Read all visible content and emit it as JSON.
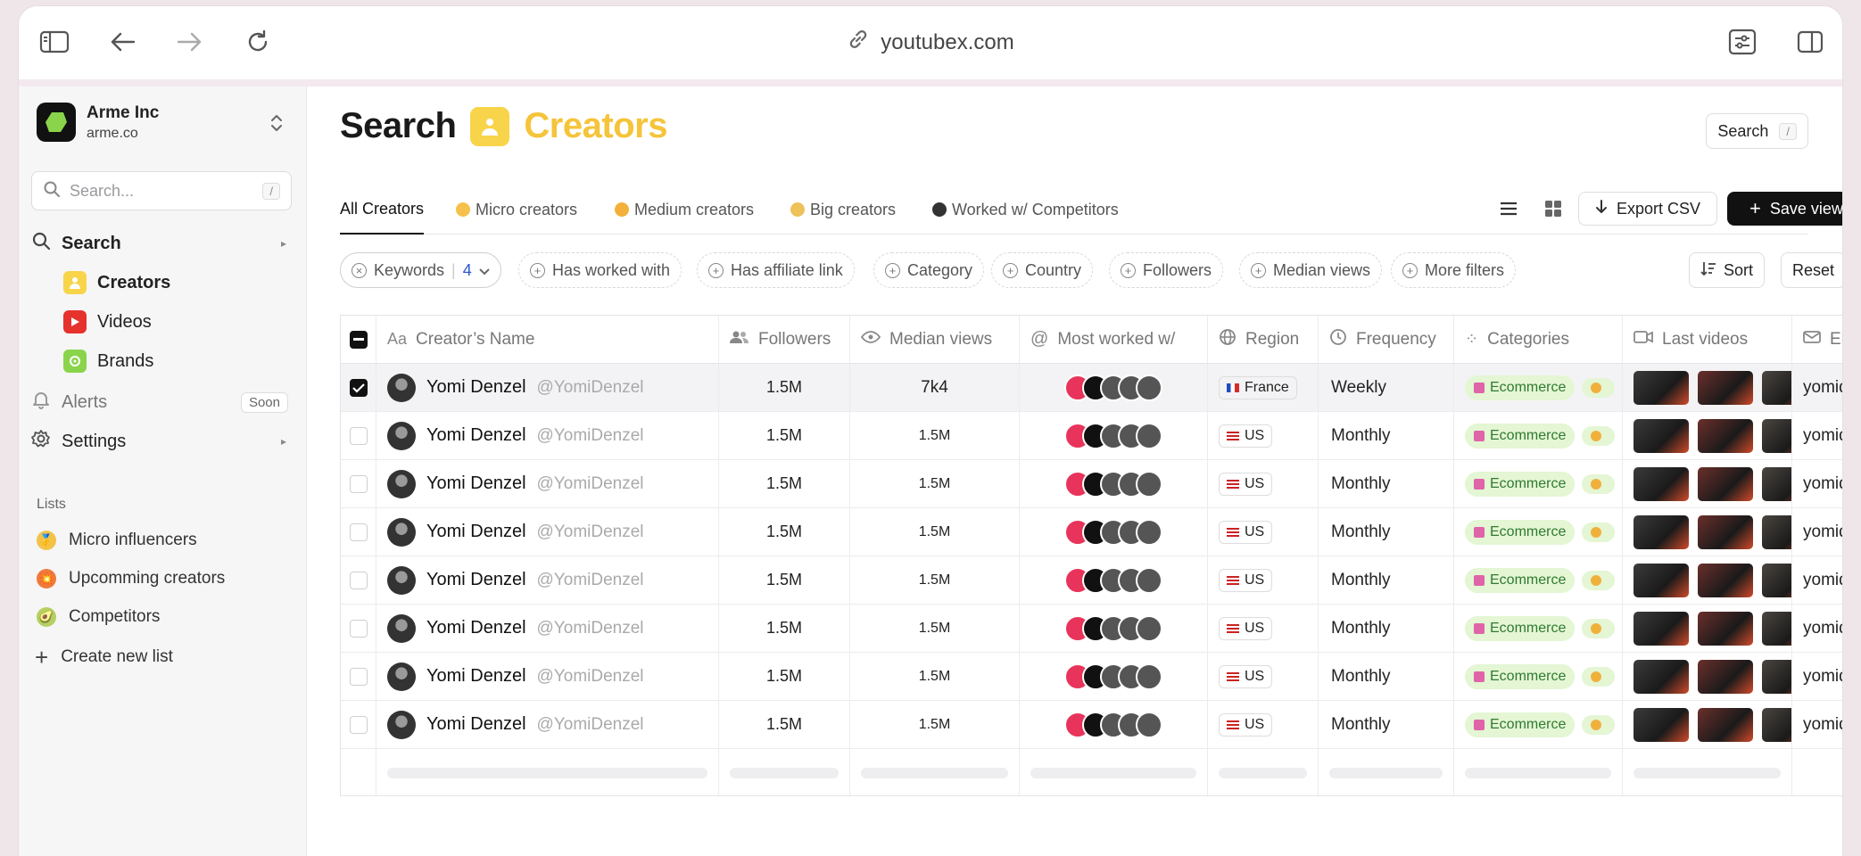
{
  "browser": {
    "url": "youtubex.com",
    "icons": [
      "sidebar-toggle-icon",
      "back-arrow-icon",
      "forward-arrow-icon",
      "reload-icon",
      "link-icon",
      "settings-sliders-icon",
      "split-view-icon"
    ]
  },
  "org": {
    "name": "Arme Inc",
    "domain": "arme.co"
  },
  "sidebar": {
    "search_placeholder": "Search...",
    "search_kbd": "/",
    "nav": {
      "search": "Search",
      "creators": "Creators",
      "videos": "Videos",
      "brands": "Brands",
      "alerts": "Alerts",
      "alerts_badge": "Soon",
      "settings": "Settings"
    },
    "lists_label": "Lists",
    "lists": [
      "Micro influencers",
      "Upcomming creators",
      "Competitors"
    ],
    "create_list": "Create new list"
  },
  "header": {
    "title": "Search",
    "subtitle": "Creators",
    "search_button": "Search",
    "search_kbd": "/"
  },
  "tabs": [
    "All Creators",
    "Micro creators",
    "Medium creators",
    "Big creators",
    "Worked w/ Competitors"
  ],
  "toolbar": {
    "export": "Export CSV",
    "save": "Save view"
  },
  "filters": {
    "keywords_label": "Keywords",
    "keywords_count": "4",
    "chips": [
      "Has worked with",
      "Has affiliate link",
      "Category",
      "Country",
      "Followers",
      "Median views",
      "More filters"
    ],
    "sort": "Sort",
    "reset": "Reset"
  },
  "table": {
    "columns": [
      "Creator’s Name",
      "Followers",
      "Median views",
      "Most worked w/",
      "Region",
      "Frequency",
      "Categories",
      "Last videos",
      "Er"
    ],
    "rows": [
      {
        "name": "Yomi Denzel",
        "handle": "@YomiDenzel",
        "followers": "1.5M",
        "median": "7k4",
        "region": "France",
        "frequency": "Weekly",
        "category": "Ecommerce",
        "email": "yomid",
        "checked": true
      },
      {
        "name": "Yomi Denzel",
        "handle": "@YomiDenzel",
        "followers": "1.5M",
        "median": "1.5M",
        "region": "US",
        "frequency": "Monthly",
        "category": "Ecommerce",
        "email": "yomid",
        "checked": false
      },
      {
        "name": "Yomi Denzel",
        "handle": "@YomiDenzel",
        "followers": "1.5M",
        "median": "1.5M",
        "region": "US",
        "frequency": "Monthly",
        "category": "Ecommerce",
        "email": "yomid",
        "checked": false
      },
      {
        "name": "Yomi Denzel",
        "handle": "@YomiDenzel",
        "followers": "1.5M",
        "median": "1.5M",
        "region": "US",
        "frequency": "Monthly",
        "category": "Ecommerce",
        "email": "yomid",
        "checked": false
      },
      {
        "name": "Yomi Denzel",
        "handle": "@YomiDenzel",
        "followers": "1.5M",
        "median": "1.5M",
        "region": "US",
        "frequency": "Monthly",
        "category": "Ecommerce",
        "email": "yomid",
        "checked": false
      },
      {
        "name": "Yomi Denzel",
        "handle": "@YomiDenzel",
        "followers": "1.5M",
        "median": "1.5M",
        "region": "US",
        "frequency": "Monthly",
        "category": "Ecommerce",
        "email": "yomid",
        "checked": false
      },
      {
        "name": "Yomi Denzel",
        "handle": "@YomiDenzel",
        "followers": "1.5M",
        "median": "1.5M",
        "region": "US",
        "frequency": "Monthly",
        "category": "Ecommerce",
        "email": "yomid",
        "checked": false
      },
      {
        "name": "Yomi Denzel",
        "handle": "@YomiDenzel",
        "followers": "1.5M",
        "median": "1.5M",
        "region": "US",
        "frequency": "Monthly",
        "category": "Ecommerce",
        "email": "yomid",
        "checked": false
      }
    ]
  },
  "colors": {
    "accent_yellow": "#f8d44a",
    "brand_red": "#e8345a",
    "category_green": "#e4f6d4",
    "videos_red": "#e5322d",
    "brands_green": "#8ad44b"
  }
}
